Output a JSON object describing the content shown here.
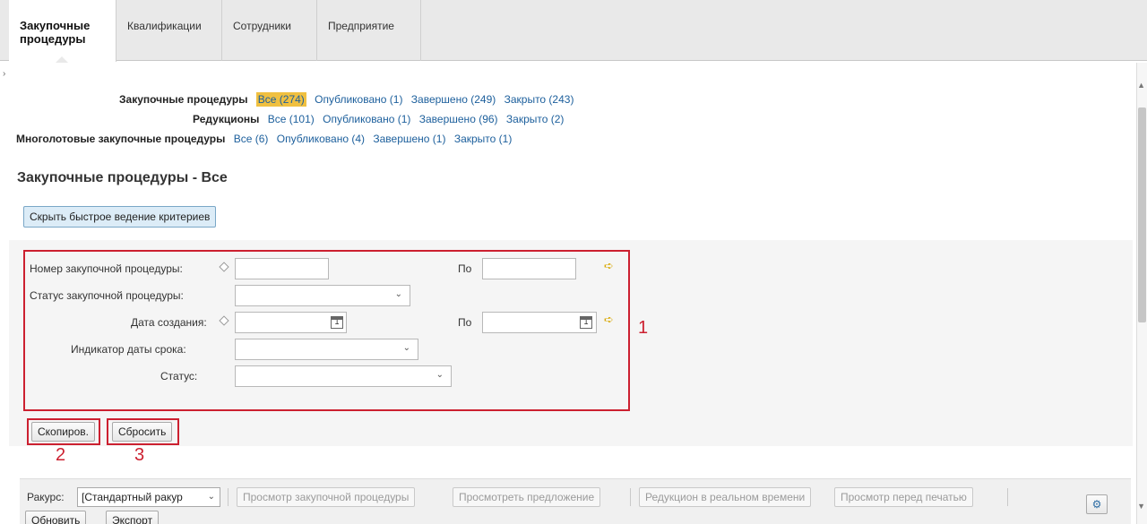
{
  "tabs": [
    {
      "label": "Закупочные процедуры",
      "active": true
    },
    {
      "label": "Квалификации",
      "active": false
    },
    {
      "label": "Сотрудники",
      "active": false
    },
    {
      "label": "Предприятие",
      "active": false
    }
  ],
  "queries": [
    {
      "label": "Закупочные процедуры",
      "links": [
        "Все (274)",
        "Опубликовано (1)",
        "Завершено (249)",
        "Закрыто (243)"
      ]
    },
    {
      "label": "Редукционы",
      "links": [
        "Все (101)",
        "Опубликовано (1)",
        "Завершено (96)",
        "Закрыто (2)"
      ]
    },
    {
      "label": "Многолотовые закупочные процедуры",
      "links": [
        "Все (6)",
        "Опубликовано (4)",
        "Завершено (1)",
        "Закрыто (1)"
      ]
    }
  ],
  "section_title": "Закупочные процедуры - Все",
  "hide_criteria_button": "Скрыть быстрое ведение критериев",
  "criteria": {
    "number_label": "Номер закупочной процедуры:",
    "status_proc_label": "Статус закупочной процедуры:",
    "created_label": "Дата создания:",
    "deadline_label": "Индикатор даты срока:",
    "status_label": "Статус:",
    "to_label": "По",
    "calendar_day": "1"
  },
  "buttons": {
    "copy": "Скопиров.",
    "reset": "Сбросить"
  },
  "annotations": {
    "box": "1",
    "copy": "2",
    "reset": "3"
  },
  "toolbar": {
    "view_label": "Ракурс:",
    "view_value": "[Стандартный ракур",
    "view_proc": "Просмотр закупочной процедуры",
    "view_offer": "Просмотреть предложение",
    "realtime": "Редукцион в реальном времени",
    "print_preview": "Просмотр перед печатью",
    "refresh": "Обновить",
    "export": "Экспорт"
  },
  "colors": {
    "accent": "#1c5f9c",
    "highlight": "#f0c040",
    "annotation": "#cc2030"
  }
}
